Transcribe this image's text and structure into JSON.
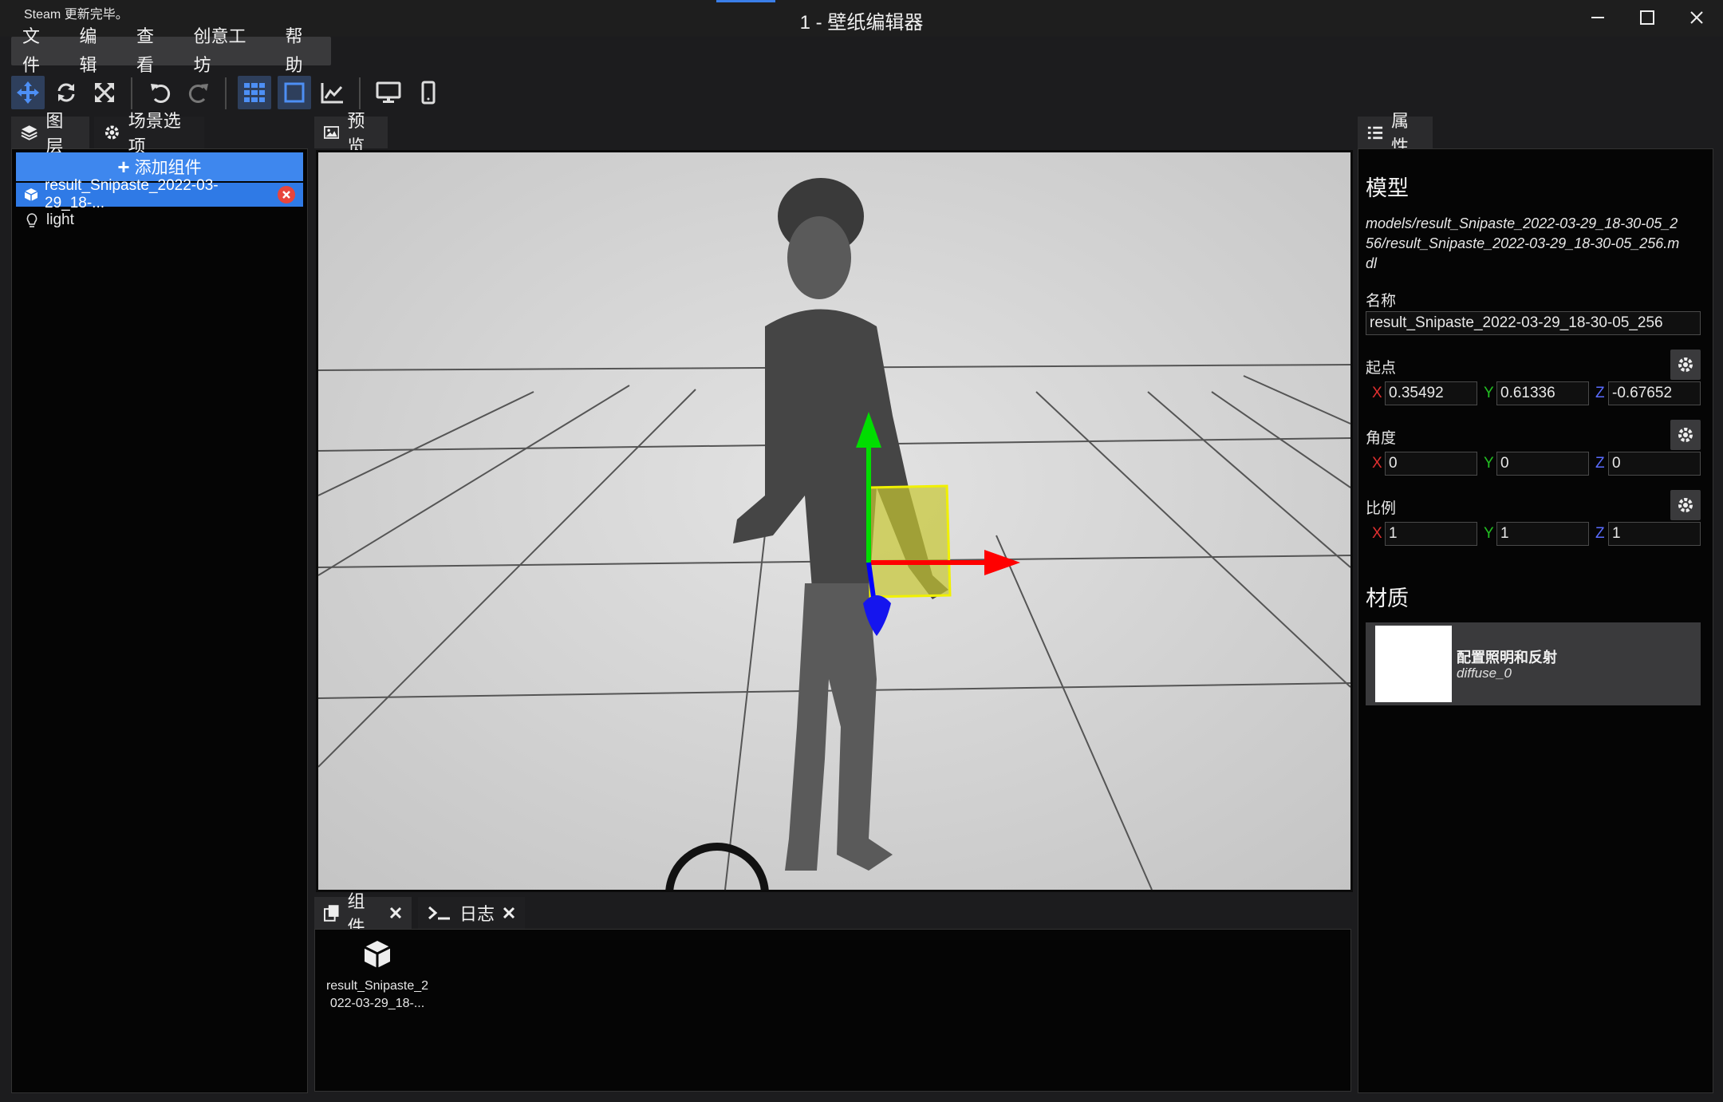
{
  "titlebar": {
    "steam_note": "Steam 更新完毕。",
    "title": "1 - 壁纸编辑器"
  },
  "menu": [
    "文件",
    "编辑",
    "查看",
    "创意工坊",
    "帮助"
  ],
  "left_tabs": {
    "layers": "图层",
    "scene": "场景选项"
  },
  "layers": {
    "add_component": "添加组件",
    "items": [
      "result_Snipaste_2022-03-29_18-...",
      "light"
    ]
  },
  "preview": {
    "tab": "预览"
  },
  "bottom": {
    "tabs": [
      "组件",
      "日志"
    ],
    "component_label": "result_Snipaste_2\n022-03-29_18-..."
  },
  "properties": {
    "tab": "属性",
    "model_heading": "模型",
    "model_path": "models/result_Snipaste_2022-03-29_18-30-05_256/result_Snipaste_2022-03-29_18-30-05_256.mdl",
    "name_label": "名称",
    "name_value": "result_Snipaste_2022-03-29_18-30-05_256",
    "origin_label": "起点",
    "origin": {
      "x": "0.35492",
      "y": "0.61336",
      "z": "-0.67652"
    },
    "angle_label": "角度",
    "angle": {
      "x": "0",
      "y": "0",
      "z": "0"
    },
    "scale_label": "比例",
    "scale": {
      "x": "1",
      "y": "1",
      "z": "1"
    },
    "axis_labels": {
      "x": "X",
      "y": "Y",
      "z": "Z"
    },
    "material_heading": "材质",
    "material_title": "配置照明和反射",
    "material_sub": "diffuse_0"
  },
  "colors": {
    "accent": "#3e87ee",
    "axis_x": "#e03030",
    "axis_y": "#22c022",
    "axis_z": "#5a6cff"
  }
}
